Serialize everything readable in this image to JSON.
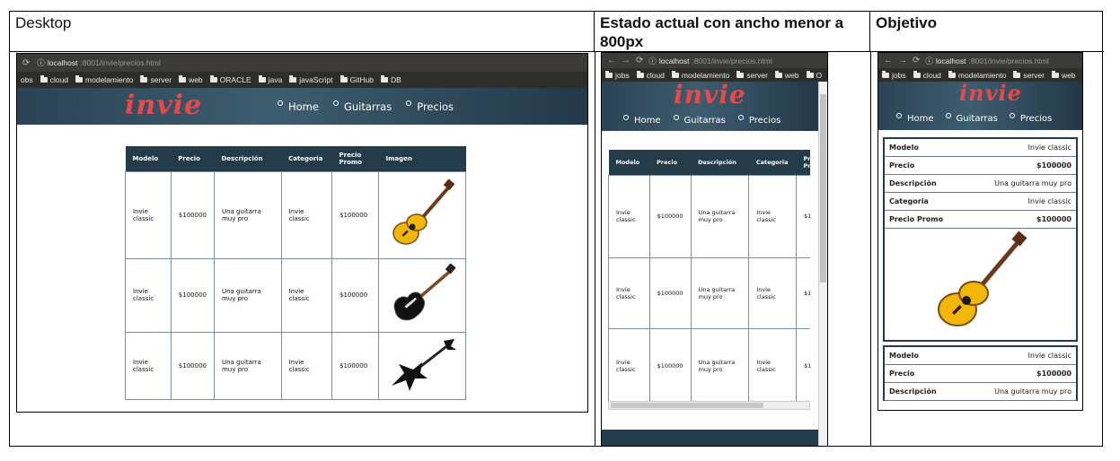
{
  "doc": {
    "col1_title": "Desktop",
    "col2_title": "Estado actual con ancho menor a  800px",
    "col3_title": "Objetivo"
  },
  "browser": {
    "url_host": "localhost",
    "url_rest": ":8001/invie/precios.html",
    "bookmarks_desktop": [
      "obs",
      "cloud",
      "modelamiento",
      "server",
      "web",
      "ORACLE",
      "java",
      "javaScript",
      "GitHub",
      "DB"
    ],
    "bookmarks_narrow": [
      "jobs",
      "cloud",
      "modelamiento",
      "server",
      "web",
      "O"
    ],
    "bookmarks_objetivo": [
      "jobs",
      "cloud",
      "modelamiento",
      "server",
      "web"
    ]
  },
  "site": {
    "logo": "invie",
    "menu": [
      "Home",
      "Guitarras",
      "Precios"
    ]
  },
  "table": {
    "headers": [
      "Modelo",
      "Precio",
      "Descripción",
      "Categoria",
      "Precio Promo",
      "Imagen"
    ],
    "rows": [
      {
        "modelo": "Invie classic",
        "precio": "$100000",
        "descripcion": "Una guitarra muy pro",
        "categoria": "Invie classic",
        "promo": "$100000",
        "imagen": "acoustic-guitar"
      },
      {
        "modelo": "Invie classic",
        "precio": "$100000",
        "descripcion": "Una guitarra muy pro",
        "categoria": "Invie classic",
        "promo": "$100000",
        "imagen": "electric-guitar"
      },
      {
        "modelo": "Invie classic",
        "precio": "$100000",
        "descripcion": "Una guitarra muy pro",
        "categoria": "Invie classic",
        "promo": "$100000",
        "imagen": "metal-guitar"
      }
    ]
  },
  "card": {
    "labels": [
      "Modelo",
      "Precio",
      "Descripción",
      "Categoria",
      "Precio Promo"
    ],
    "values": [
      "Invie classic",
      "$100000",
      "Una guitarra muy pro",
      "Invie classic",
      "$100000"
    ]
  },
  "colors": {
    "header_bg": "#243b4a",
    "logo": "#e9494a",
    "guitar_yellow": "#f2b705"
  }
}
